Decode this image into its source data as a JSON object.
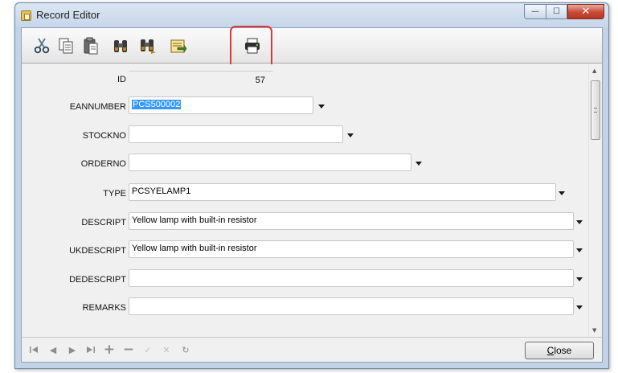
{
  "window": {
    "title": "Record Editor",
    "minimize_glyph": "—",
    "maximize_glyph": "☐",
    "close_glyph": "✕"
  },
  "toolbar": {
    "buttons": [
      {
        "name": "cut-button",
        "icon": "scissors-icon"
      },
      {
        "name": "copy-button",
        "icon": "copy-icon"
      },
      {
        "name": "paste-button",
        "icon": "paste-icon"
      },
      {
        "name": "find-button",
        "icon": "binoculars-icon"
      },
      {
        "name": "find-next-button",
        "icon": "binoculars-next-icon"
      },
      {
        "name": "export-button",
        "icon": "export-icon"
      },
      {
        "name": "print-button",
        "icon": "printer-icon"
      }
    ],
    "highlighted": "print-button",
    "highlight_color": "#e03535"
  },
  "fields": {
    "id": {
      "label": "ID",
      "value": "57"
    },
    "eannumber": {
      "label": "EANNUMBER",
      "value": "PCS500002"
    },
    "stockno": {
      "label": "STOCKNO",
      "value": ""
    },
    "orderno": {
      "label": "ORDERNO",
      "value": ""
    },
    "type": {
      "label": "TYPE",
      "value": "PCSYELAMP1"
    },
    "descript": {
      "label": "DESCRIPT",
      "value": "Yellow lamp with built-in resistor"
    },
    "ukdescript": {
      "label": "UKDESCRIPT",
      "value": "Yellow lamp with built-in resistor"
    },
    "dedescript": {
      "label": "DEDESCRIPT",
      "value": ""
    },
    "remarks": {
      "label": "REMARKS",
      "value": ""
    }
  },
  "navigator": {
    "first": "◀",
    "prior": "◀",
    "next": "▶",
    "last": "▶",
    "insert": "+",
    "delete": "−",
    "post": "✓",
    "cancel": "✕",
    "refresh": "↻"
  },
  "close_button": {
    "prefix": "C",
    "rest": "lose"
  },
  "colors": {
    "selection": "#3399ff",
    "titlebar": "#c6d6ea",
    "close_caption": "#c74a35"
  }
}
